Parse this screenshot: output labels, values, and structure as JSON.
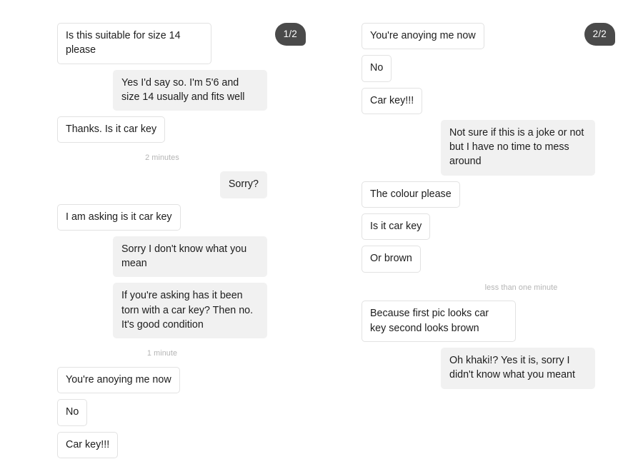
{
  "page": {
    "title": "Messaging conversation screenshots",
    "background_color": "#ffffff",
    "accent_badge_color": "#4a4a4a",
    "incoming_bubble_color": "#ffffff",
    "incoming_bubble_border": "#e2e2e2",
    "outgoing_bubble_color": "#f1f1f1",
    "text_color": "#1d1d1d",
    "timestamp_color": "#b4b4b4"
  },
  "columns": [
    {
      "id": "conversation-part-1",
      "badge": "1/2",
      "items": [
        {
          "kind": "message",
          "direction": "incoming",
          "text": "Is this suitable for size 14 please"
        },
        {
          "kind": "message",
          "direction": "outgoing",
          "text": "Yes I'd say so. I'm 5'6 and size 14 usually and fits well"
        },
        {
          "kind": "message",
          "direction": "incoming",
          "text": "Thanks. Is it car key"
        },
        {
          "kind": "timestamp",
          "text": "2 minutes"
        },
        {
          "kind": "message",
          "direction": "outgoing",
          "text": "Sorry?"
        },
        {
          "kind": "message",
          "direction": "incoming",
          "text": "I am asking is it car key"
        },
        {
          "kind": "message",
          "direction": "outgoing",
          "text": "Sorry I don't know what you mean"
        },
        {
          "kind": "message",
          "direction": "outgoing",
          "text": "If you're asking has it been torn with a car key? Then no. It's good condition"
        },
        {
          "kind": "timestamp",
          "text": "1 minute"
        },
        {
          "kind": "message",
          "direction": "incoming",
          "text": "You're anoying me now"
        },
        {
          "kind": "message",
          "direction": "incoming",
          "text": "No"
        },
        {
          "kind": "message",
          "direction": "incoming",
          "text": "Car key!!!"
        }
      ]
    },
    {
      "id": "conversation-part-2",
      "badge": "2/2",
      "items": [
        {
          "kind": "message",
          "direction": "incoming",
          "text": "You're anoying me now"
        },
        {
          "kind": "message",
          "direction": "incoming",
          "text": "No"
        },
        {
          "kind": "message",
          "direction": "incoming",
          "text": "Car key!!!"
        },
        {
          "kind": "message",
          "direction": "outgoing",
          "text": "Not sure if this is a joke or not but I have no time to mess around"
        },
        {
          "kind": "message",
          "direction": "incoming",
          "text": "The colour please"
        },
        {
          "kind": "message",
          "direction": "incoming",
          "text": "Is it car key"
        },
        {
          "kind": "message",
          "direction": "incoming",
          "text": "Or brown"
        },
        {
          "kind": "timestamp",
          "text": "less than one minute"
        },
        {
          "kind": "message",
          "direction": "incoming",
          "text": "Because first pic looks car key second looks brown"
        },
        {
          "kind": "message",
          "direction": "outgoing",
          "text": "Oh khaki!? Yes it is, sorry I didn't know what you meant"
        }
      ]
    }
  ]
}
